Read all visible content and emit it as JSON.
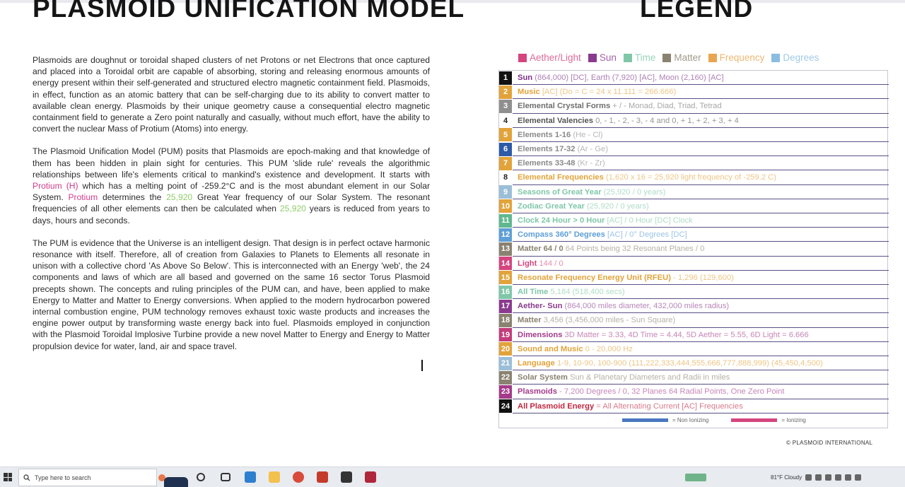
{
  "title": "PLASMOID UNIFICATION MODEL",
  "legend_title": "LEGEND",
  "paragraphs": {
    "p1": "Plasmoids are doughnut or toroidal shaped clusters of net Protons or net Electrons that once captured and placed into a Toroidal orbit are capable of absorbing, storing and releasing enormous amounts of energy present within their self-generated and structured electro magnetic containment field. Plasmoids, in effect, function as an atomic battery that can be self-charging due to its ability to convert matter to available clean energy. Plasmoids by their unique geometry cause a consequential electro magnetic containment field to generate a Zero point naturally and casually, without much effort, have the ability to convert the nuclear Mass of Protium (Atoms) into energy.",
    "p2_a": "The Plasmoid Unification Model (PUM) posits that Plasmoids are epoch-making and that knowledge of them has been hidden in plain sight for centuries. This PUM 'slide rule' reveals the algorithmic relationships between life's elements critical to mankind's existence and development. It starts with ",
    "p2_protium_h": "Protium (H)",
    "p2_b": " which has a melting point of ",
    "p2_temp": "-259.2°C",
    "p2_c": " and is the most abundant element in our Solar System. ",
    "p2_protium": "Protium",
    "p2_d": " determines the ",
    "p2_num1": "25,920",
    "p2_e": " Great Year frequency of our Solar System. The resonant frequencies of all other elements can then be calculated when ",
    "p2_num2": "25,920",
    "p2_f": " years is reduced from years to days, hours and seconds.",
    "p3": "The PUM is evidence that the Universe is an intelligent design. That design is in perfect octave harmonic resonance with itself. Therefore, all of creation from Galaxies to Planets to Elements all resonate in unison with a collective chord 'As Above So Below'. This is interconnected with an Energy 'web', the 24 components and laws of which are all based and governed on the same 16 sector Torus Plasmoid precepts shown. The concepts and ruling principles of the PUM can, and have, been applied to make Energy to Matter and Matter to Energy conversions. When applied to the modern hydrocarbon powered internal combustion engine, PUM technology removes exhaust toxic waste products and increases the engine power output by transforming waste energy back into fuel. Plasmoids employed in conjunction with the Plasmoid Toroidal Implosive Turbine provide a new novel Matter to Energy and Energy to Matter propulsion device for water, land, air and space travel."
  },
  "legend_key": [
    {
      "label": "Aether/Light",
      "color": "#d4457f"
    },
    {
      "label": "Sun",
      "color": "#8a3a8e"
    },
    {
      "label": "Time",
      "color": "#7fc7a8"
    },
    {
      "label": "Matter",
      "color": "#8a8270"
    },
    {
      "label": "Frequency",
      "color": "#e8a650"
    },
    {
      "label": "Degrees",
      "color": "#8bbde0"
    }
  ],
  "legend_rows": [
    {
      "num": "1",
      "color": "#111111",
      "tcolor": "#7b2f86",
      "title": "Sun",
      "desc": " (864,000) [DC], Earth (7,920) [AC], Moon (2,160) [AC]"
    },
    {
      "num": "2",
      "color": "#e2a33a",
      "tcolor": "#e2a33a",
      "title": "Music",
      "desc": " [AC] (Do = C = 24 x 11.111 = 266.666)"
    },
    {
      "num": "3",
      "color": "#8f8f8f",
      "tcolor": "#6f6f6f",
      "title": "Elemental Crystal Forms",
      "desc": " + / - Monad, Diad, Triad, Tetrad"
    },
    {
      "num": "4",
      "color": "#ffffff",
      "tcolor": "#555555",
      "title": "Elemental Valencies",
      "desc": " 0, - 1, - 2, - 3, - 4 and 0, + 1, + 2, + 3, + 4"
    },
    {
      "num": "5",
      "color": "#e2a33a",
      "tcolor": "#8a8a8a",
      "title": "Elements 1-16",
      "desc": " (He - Cl)"
    },
    {
      "num": "6",
      "color": "#2d5aa8",
      "tcolor": "#8a8a8a",
      "title": "Elements 17-32",
      "desc": " (Ar - Ge)"
    },
    {
      "num": "7",
      "color": "#e2a33a",
      "tcolor": "#8a8a8a",
      "title": "Elements 33-48",
      "desc": " (Kr - Zr)"
    },
    {
      "num": "8",
      "color": "#ffffff",
      "tcolor": "#e2a33a",
      "title": "Elemental Frequencies",
      "desc": " (1,620 x 16 = 25,920 light frequency of -259.2 C)"
    },
    {
      "num": "9",
      "color": "#9bbfd8",
      "tcolor": "#7fc7a8",
      "title": "Seasons of Great Year",
      "desc": " (25,920 / 0 years)"
    },
    {
      "num": "10",
      "color": "#e2a33a",
      "tcolor": "#7fc7a8",
      "title": "Zodiac Great Year",
      "desc": " (25,920 / 0 years)"
    },
    {
      "num": "11",
      "color": "#5fb890",
      "tcolor": "#7fc7a8",
      "title": "Clock 24 Hour > 0 Hour",
      "desc": " [AC] / 0 Hour [DC] Clock"
    },
    {
      "num": "12",
      "color": "#5e9fd6",
      "tcolor": "#5e9fd6",
      "title": "Compass 360° Degrees",
      "desc": " [AC] / 0° Degrees [DC]"
    },
    {
      "num": "13",
      "color": "#8a8270",
      "tcolor": "#8a8270",
      "title": "Matter 64 / 0",
      "desc": " 64 Points being 32 Resonant Planes / 0"
    },
    {
      "num": "14",
      "color": "#d4457f",
      "tcolor": "#d4457f",
      "title": "Light",
      "desc": " 144 / 0"
    },
    {
      "num": "15",
      "color": "#e2a33a",
      "tcolor": "#e2a33a",
      "title": "Resonate Frequency Energy Unit (RFEU)",
      "desc": " - 1,296 (129,600)"
    },
    {
      "num": "16",
      "color": "#7fc7a8",
      "tcolor": "#7fc7a8",
      "title": "All Time",
      "desc": " 5,184 (518,400 secs)"
    },
    {
      "num": "17",
      "color": "#8a3a8e",
      "tcolor": "#8a3a8e",
      "title": "Aether- Sun",
      "desc": " (864,000 miles diameter, 432,000 miles radius)"
    },
    {
      "num": "18",
      "color": "#8a8270",
      "tcolor": "#8a8270",
      "title": "Matter",
      "desc": " 3,456 (3,456,000 miles - Sun Square)"
    },
    {
      "num": "19",
      "color": "#c43c7a",
      "tcolor": "#a43a8a",
      "title": "Dimensions",
      "desc": " 3D Matter = 3.33, 4D Time = 4.44, 5D Aether = 5.55, 6D Light = 6.666"
    },
    {
      "num": "20",
      "color": "#e2a33a",
      "tcolor": "#e2a33a",
      "title": "Sound and Music",
      "desc": " 0 - 20,000 Hz"
    },
    {
      "num": "21",
      "color": "#9bbfd8",
      "tcolor": "#e2a33a",
      "title": "Language",
      "desc": " 1-9, 10-90, 100-900 (111,222,333,444,555,666,777,888,999) (45,450,4,500)"
    },
    {
      "num": "22",
      "color": "#8a8270",
      "tcolor": "#8a8270",
      "title": "Solar System",
      "desc": " Sun & Planetary Diameters and Radii in miles"
    },
    {
      "num": "23",
      "color": "#a43a8a",
      "tcolor": "#a43a8a",
      "title": "Plasmoids",
      "desc": " - 7,200 Degrees / 0, 32 Planes 64 Radial Points, One Zero Point"
    },
    {
      "num": "24",
      "color": "#111111",
      "tcolor": "#c0283f",
      "title": "All Plasmoid Energy",
      "desc": " = All Alternating Current [AC] Frequencies"
    }
  ],
  "ionizing": {
    "non_label": "= Non Ionizing",
    "ion_label": "= Ionizing",
    "non_color": "#4a78c0",
    "ion_color": "#d4457f"
  },
  "copyright": "© PLASMOID INTERNATIONAL",
  "taskbar": {
    "search_placeholder": "Type here to search",
    "weather": "81°F  Cloudy"
  }
}
